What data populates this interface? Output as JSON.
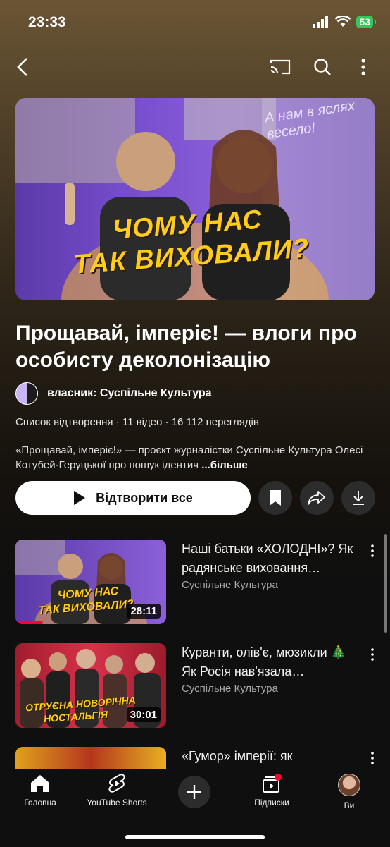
{
  "status": {
    "time": "23:33",
    "battery": "53"
  },
  "hero": {
    "line1": "ЧОМУ НАС",
    "line2": "ТАК ВИХОВАЛИ?",
    "handwritten": "А нам в яслях весело!"
  },
  "playlist": {
    "title": "Прощавай, імперіє! — влоги про особисту деколонізацію",
    "owner": "власник: Суспільне Культура",
    "type": "Список відтворення",
    "count": "11 відео",
    "views": "16 112 переглядів",
    "description": "«Прощавай, імперіє!» — проєкт журналістки Суспільне Культура Олесі Котубей-Геруцької про пошук ідентич",
    "more": "...більше",
    "play_all": "Відтворити все"
  },
  "videos": [
    {
      "title": "Наші батьки «ХОЛОДНІ»? Як радянське виховання…",
      "channel": "Суспільне Культура",
      "duration": "28:11",
      "thumb_text1": "ЧОМУ НАС",
      "thumb_text2": "ТАК ВИХОВАЛИ?",
      "progress": 0.18
    },
    {
      "title": "Куранти, олів'є, мюзикли 🎄 Як Росія нав'язала…",
      "channel": "Суспільне Культура",
      "duration": "30:01",
      "thumb_text1": "ОТРУЄНА НОВОРІЧНА",
      "thumb_text2": "НОСТАЛЬГІЯ"
    },
    {
      "title": "«Гумор» імперії: як",
      "channel": "",
      "duration": ""
    }
  ],
  "tabs": [
    {
      "label": "Головна",
      "icon": "home-icon"
    },
    {
      "label": "YouTube Shorts",
      "icon": "shorts-icon"
    },
    {
      "label": "",
      "icon": "create-icon"
    },
    {
      "label": "Підписки",
      "icon": "subscriptions-icon"
    },
    {
      "label": "Ви",
      "icon": "avatar"
    }
  ],
  "colors": {
    "accent": "#ffcc1a",
    "battery": "#34c759",
    "progress": "#ff0033"
  }
}
